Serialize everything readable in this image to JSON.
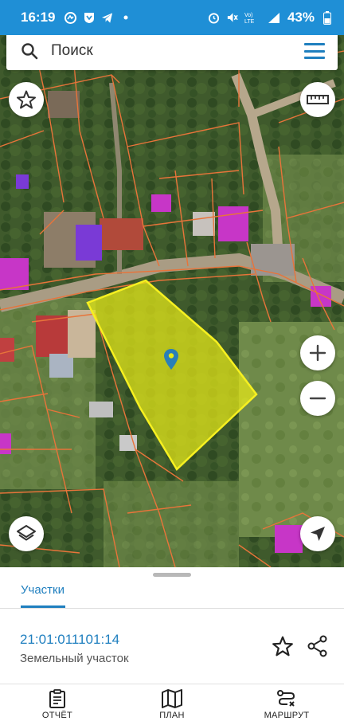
{
  "status_bar": {
    "time": "16:19",
    "battery": "43%",
    "network": "4G+"
  },
  "search": {
    "placeholder": "Поиск"
  },
  "icons": {
    "search": "search-icon",
    "menu": "menu-icon",
    "favorite": "star-icon",
    "ruler": "ruler-icon",
    "zoom_in": "plus-icon",
    "zoom_out": "minus-icon",
    "layers": "layers-icon",
    "locate": "navigation-arrow-icon",
    "share": "share-icon",
    "parcel_marker": "map-pin-icon"
  },
  "colors": {
    "accent": "#1f7fbf",
    "status_bar": "#1f8fd6",
    "parcel_fill": "#e7ea17",
    "parcel_border": "#f6f020",
    "cadastral_lines": "#e8743a",
    "building_highlight": "#cc33cc"
  },
  "sheet": {
    "tab_label": "Участки",
    "parcel_number": "21:01:011101:14",
    "parcel_type": "Земельный участок"
  },
  "bottom_nav": {
    "items": [
      {
        "label": "ОТЧЁТ",
        "icon": "clipboard-icon"
      },
      {
        "label": "ПЛАН",
        "icon": "map-icon"
      },
      {
        "label": "МАРШРУТ",
        "icon": "route-icon"
      }
    ]
  }
}
